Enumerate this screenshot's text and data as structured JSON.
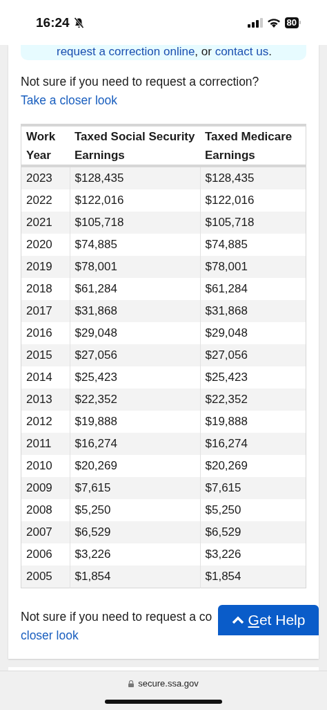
{
  "status_bar": {
    "time": "16:24",
    "battery": "80"
  },
  "alert": {
    "parts": [
      {
        "kind": "link",
        "text": "request a correction online"
      },
      {
        "kind": "text",
        "text": ", or "
      },
      {
        "kind": "link",
        "text": "contact us"
      },
      {
        "kind": "text",
        "text": "."
      }
    ]
  },
  "intro": {
    "text": "Not sure if you need to request a correction? ",
    "link": "Take a closer look"
  },
  "table": {
    "columns": [
      "Work Year",
      "Taxed Social Security Earnings",
      "Taxed Medicare Earnings"
    ],
    "rows": [
      [
        "2023",
        "$128,435",
        "$128,435"
      ],
      [
        "2022",
        "$122,016",
        "$122,016"
      ],
      [
        "2021",
        "$105,718",
        "$105,718"
      ],
      [
        "2020",
        "$74,885",
        "$74,885"
      ],
      [
        "2019",
        "$78,001",
        "$78,001"
      ],
      [
        "2018",
        "$61,284",
        "$61,284"
      ],
      [
        "2017",
        "$31,868",
        "$31,868"
      ],
      [
        "2016",
        "$29,048",
        "$29,048"
      ],
      [
        "2015",
        "$27,056",
        "$27,056"
      ],
      [
        "2014",
        "$25,423",
        "$25,423"
      ],
      [
        "2013",
        "$22,352",
        "$22,352"
      ],
      [
        "2012",
        "$19,888",
        "$19,888"
      ],
      [
        "2011",
        "$16,274",
        "$16,274"
      ],
      [
        "2010",
        "$20,269",
        "$20,269"
      ],
      [
        "2009",
        "$7,615",
        "$7,615"
      ],
      [
        "2008",
        "$5,250",
        "$5,250"
      ],
      [
        "2007",
        "$6,529",
        "$6,529"
      ],
      [
        "2006",
        "$3,226",
        "$3,226"
      ],
      [
        "2005",
        "$1,854",
        "$1,854"
      ]
    ]
  },
  "footer_note": {
    "text": "Not sure if you need to request a co",
    "link": "closer look"
  },
  "help_button": {
    "label": "Get Help"
  },
  "address_bar": {
    "url": "secure.ssa.gov"
  }
}
